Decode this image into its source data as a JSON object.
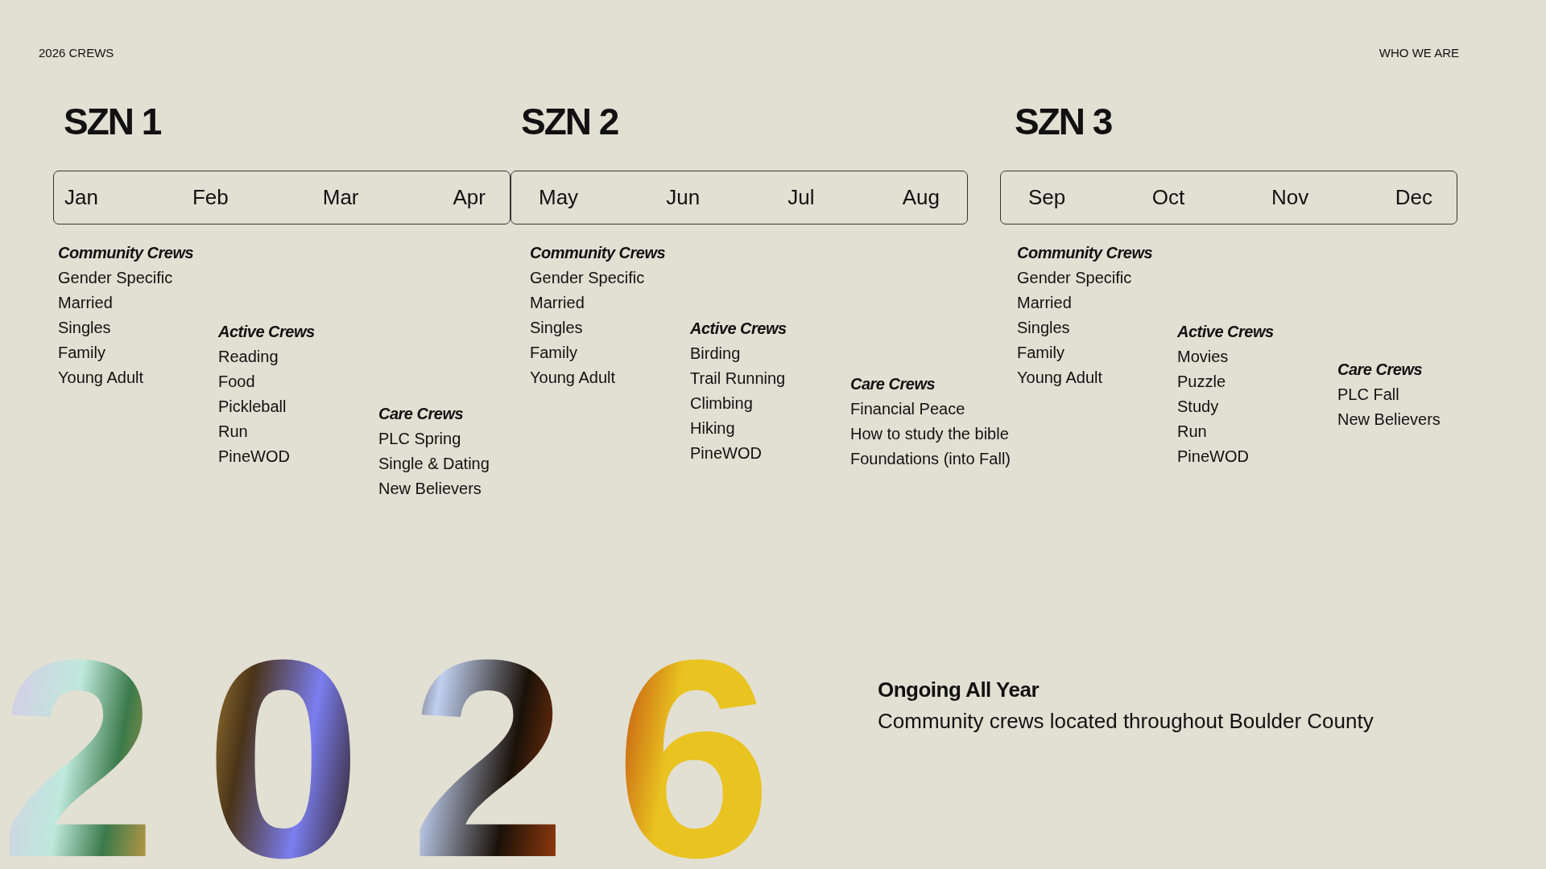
{
  "header": {
    "left": "2026 CREWS",
    "right": "WHO WE ARE"
  },
  "seasons": [
    {
      "title": "SZN 1",
      "months": [
        "Jan",
        "Feb",
        "Mar",
        "Apr"
      ],
      "groups": [
        {
          "title": "Community Crews",
          "items": [
            "Gender Specific",
            "Married",
            "Singles",
            "Family",
            "Young Adult"
          ]
        },
        {
          "title": "Active Crews",
          "items": [
            "Reading",
            "Food",
            "Pickleball",
            "Run",
            "PineWOD"
          ]
        },
        {
          "title": "Care Crews",
          "items": [
            "PLC Spring",
            "Single & Dating",
            "New Believers"
          ]
        }
      ]
    },
    {
      "title": "SZN 2",
      "months": [
        "May",
        "Jun",
        "Jul",
        "Aug"
      ],
      "groups": [
        {
          "title": "Community Crews",
          "items": [
            "Gender Specific",
            "Married",
            "Singles",
            "Family",
            "Young Adult"
          ]
        },
        {
          "title": "Active Crews",
          "items": [
            "Birding",
            "Trail Running",
            "Climbing",
            "Hiking",
            "PineWOD"
          ]
        },
        {
          "title": "Care Crews",
          "items": [
            "Financial Peace",
            "How to study the bible",
            "Foundations (into Fall)"
          ]
        }
      ]
    },
    {
      "title": "SZN 3",
      "months": [
        "Sep",
        "Oct",
        "Nov",
        "Dec"
      ],
      "groups": [
        {
          "title": "Community Crews",
          "items": [
            "Gender Specific",
            "Married",
            "Singles",
            "Family",
            "Young Adult"
          ]
        },
        {
          "title": "Active Crews",
          "items": [
            "Movies",
            "Puzzle",
            "Study",
            "Run",
            "PineWOD"
          ]
        },
        {
          "title": "Care Crews",
          "items": [
            "PLC Fall",
            "New Believers"
          ]
        }
      ]
    }
  ],
  "year": "2026",
  "ongoing": {
    "title": "Ongoing All Year",
    "text": "Community crews located throughout Boulder County"
  }
}
